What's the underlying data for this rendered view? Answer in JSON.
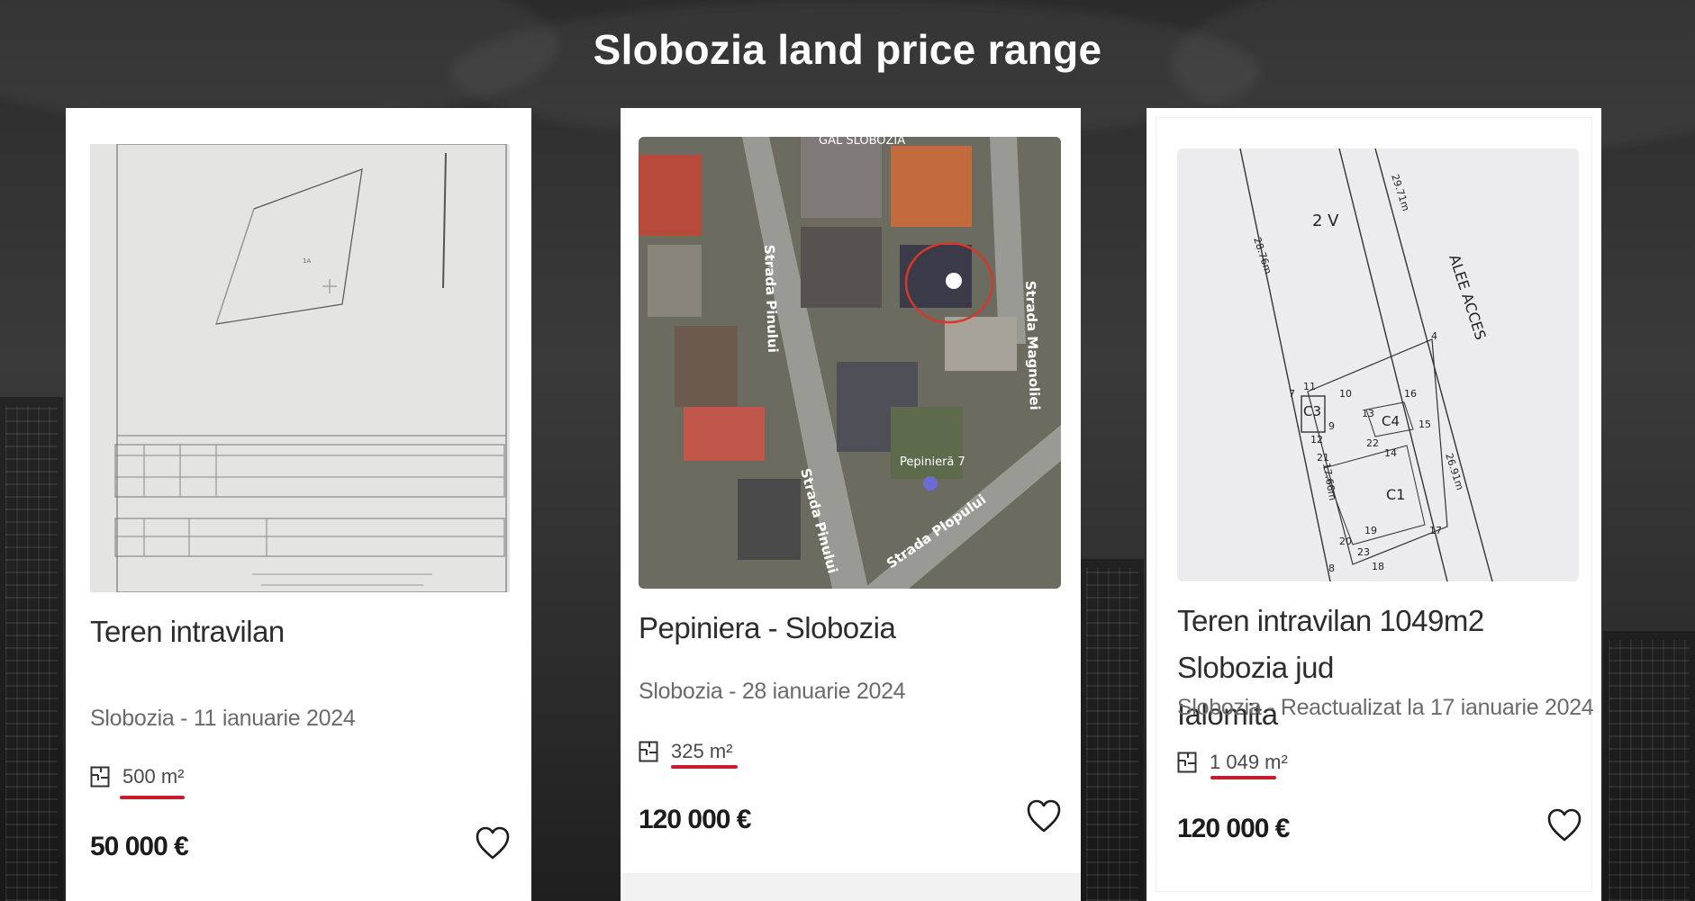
{
  "page": {
    "title": "Slobozia land price range"
  },
  "colors": {
    "underline": "#c41e2a",
    "title_text": "#ffffff",
    "card_bg": "#ffffff"
  },
  "listings": [
    {
      "title": "Teren intravilan",
      "meta": "Slobozia - 11 ianuarie 2024",
      "area": "500 m²",
      "price": "50 000 €",
      "area_icon": "floor-plan-icon",
      "favorite_icon": "heart-outline-icon"
    },
    {
      "title": "Pepiniera - Slobozia",
      "meta": "Slobozia - 28 ianuarie 2024",
      "area": "325 m²",
      "price": "120 000 €",
      "area_icon": "floor-plan-icon",
      "favorite_icon": "heart-outline-icon",
      "map_labels": {
        "top": "GAL SLOBOZIA",
        "street1": "Strada Pinului",
        "street2": "Strada Pinului",
        "street3": "Strada Magnoliei",
        "street4": "Strada Plopului",
        "poi": "Pepinieră 7"
      }
    },
    {
      "title_line1": "Teren intravilan 1049m2 Slobozia jud",
      "title_line2": "Ialomita",
      "meta": "Slobozia - Reactualizat la 17 ianuarie 2024",
      "area": "1 049 m²",
      "price": "120 000 €",
      "area_icon": "floor-plan-icon",
      "favorite_icon": "heart-outline-icon",
      "plan_labels": {
        "zone": "2 V",
        "alley": "ALEE ACCES",
        "dim1": "28.76m",
        "dim2": "29.71m",
        "dim3": "17.66m",
        "dim4": "26.91m",
        "c1": "C1",
        "c3": "C3",
        "c4": "C4",
        "p4": "4",
        "p7": "7",
        "p8": "8",
        "p9": "9",
        "p10": "10",
        "p11": "11",
        "p12": "12",
        "p13": "13",
        "p14": "14",
        "p15": "15",
        "p16": "16",
        "p17": "17",
        "p18": "18",
        "p19": "19",
        "p20": "20",
        "p21": "21",
        "p22": "22",
        "p23": "23"
      }
    }
  ]
}
